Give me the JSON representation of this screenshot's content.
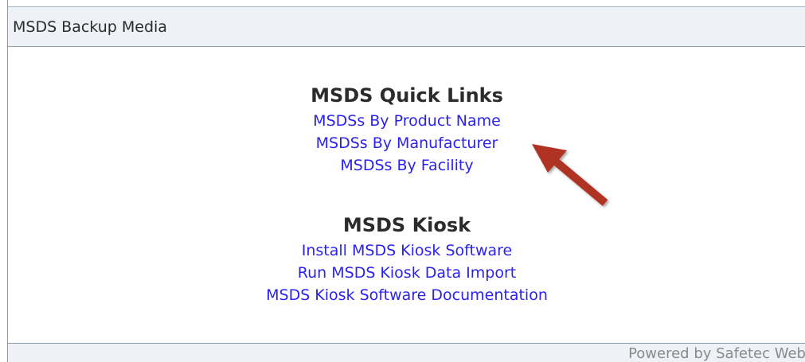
{
  "header": {
    "title": "MSDS Backup Media"
  },
  "quick_links": {
    "heading": "MSDS Quick Links",
    "items": [
      "MSDSs By Product Name",
      "MSDSs By Manufacturer",
      "MSDSs By Facility"
    ]
  },
  "kiosk": {
    "heading": "MSDS Kiosk",
    "items": [
      "Install MSDS Kiosk Software",
      "Run MSDS Kiosk Data Import",
      "MSDS Kiosk Software Documentation"
    ]
  },
  "footer": {
    "text": "Powered by Safetec Web"
  },
  "colors": {
    "link": "#2b22ee",
    "header_bg": "#eef1f5",
    "arrow": "#b03024"
  },
  "annotation": {
    "icon": "red-arrow-icon"
  }
}
